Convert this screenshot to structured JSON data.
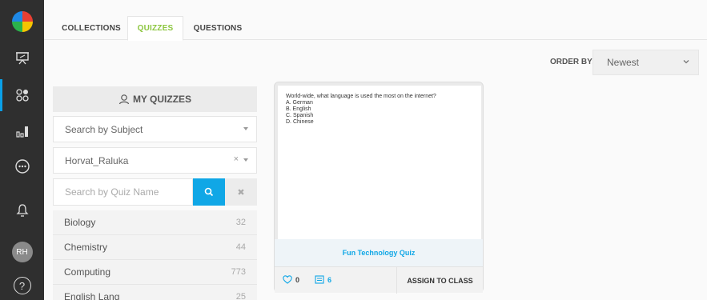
{
  "sidebar": {
    "items": [
      {
        "icon": "presentation-icon"
      },
      {
        "icon": "quizzes-grid-icon",
        "active": true
      },
      {
        "icon": "bar-chart-icon"
      },
      {
        "icon": "more-icon"
      },
      {
        "icon": "bell-icon"
      }
    ],
    "avatar_initials": "RH",
    "help_label": "?"
  },
  "tabs": [
    "COLLECTIONS",
    "QUIZZES",
    "QUESTIONS"
  ],
  "active_tab": "QUIZZES",
  "order_by": {
    "label": "ORDER BY:",
    "value": "Newest"
  },
  "filters": {
    "my_quizzes_label": "MY QUIZZES",
    "subject_placeholder": "Search by Subject",
    "owner_value": "Horvat_Raluka",
    "quiz_name_placeholder": "Search by Quiz Name",
    "clear_glyph": "×",
    "reset_glyph": "✖"
  },
  "subjects": [
    {
      "name": "Biology",
      "count": "32"
    },
    {
      "name": "Chemistry",
      "count": "44"
    },
    {
      "name": "Computing",
      "count": "773"
    },
    {
      "name": "English Lang",
      "count": "25"
    }
  ],
  "quiz_card": {
    "question": "World-wide, what language is used the most on the internet?",
    "options": [
      "A. German",
      "B. English",
      "C. Spanish",
      "D. Chinese"
    ],
    "title": "Fun Technology Quiz",
    "likes": "0",
    "questions_count": "6",
    "assign_label": "ASSIGN TO CLASS"
  },
  "colors": {
    "accent_blue": "#10a7e6",
    "active_tab_green": "#8cc63f",
    "sidebar_bg": "#2f2f2f"
  }
}
